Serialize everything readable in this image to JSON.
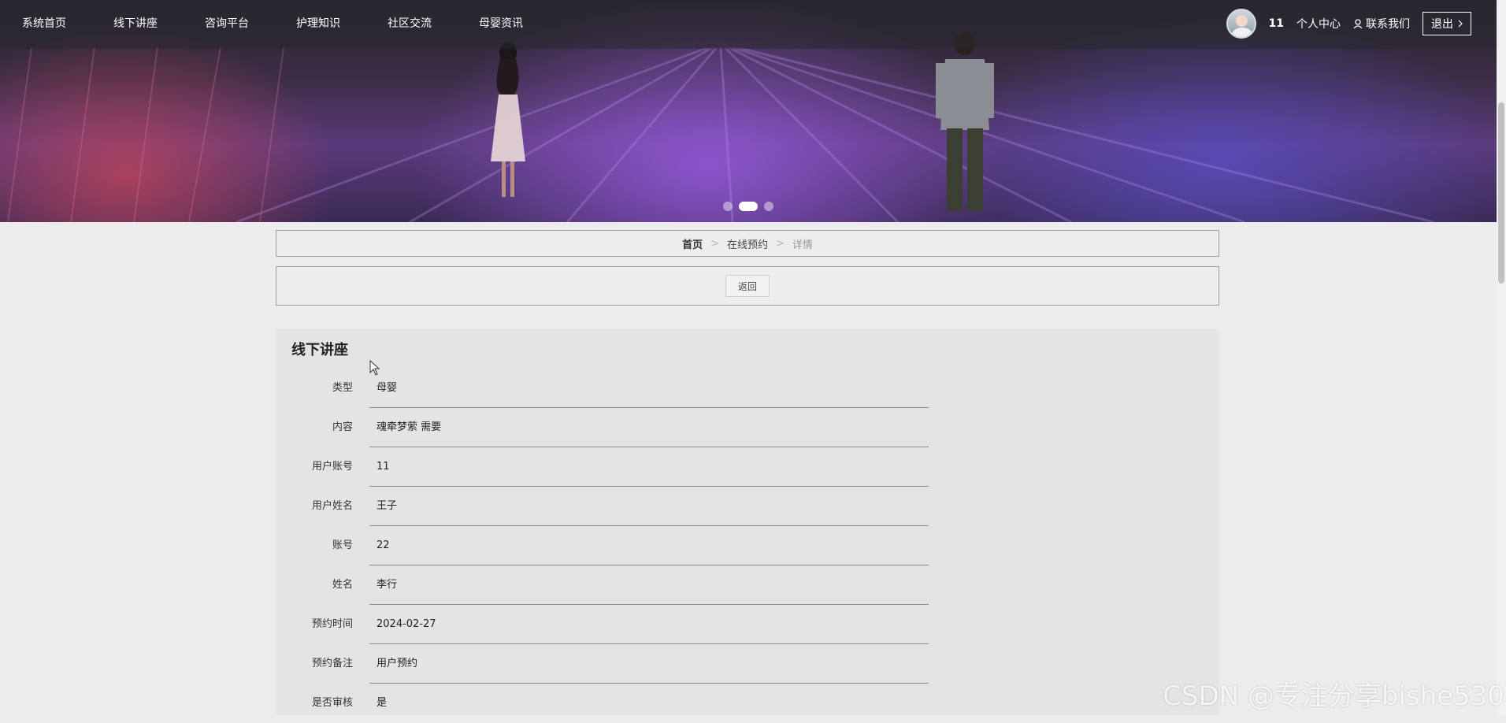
{
  "nav": {
    "items": [
      {
        "label": "系统首页"
      },
      {
        "label": "线下讲座"
      },
      {
        "label": "咨询平台"
      },
      {
        "label": "护理知识"
      },
      {
        "label": "社区交流"
      },
      {
        "label": "母婴资讯"
      }
    ]
  },
  "user": {
    "count": "11",
    "personal_center": "个人中心",
    "contact": "联系我们",
    "logout": "退出"
  },
  "banner": {
    "slides_total": 3,
    "active_slide": 2
  },
  "breadcrumb": {
    "home": "首页",
    "section": "在线预约",
    "current": "详情",
    "separator": ">"
  },
  "actions": {
    "back": "返回"
  },
  "detail": {
    "title": "线下讲座",
    "fields": [
      {
        "label": "类型",
        "value": "母婴"
      },
      {
        "label": "内容",
        "value": "魂牵梦萦 需要"
      },
      {
        "label": "用户账号",
        "value": "11"
      },
      {
        "label": "用户姓名",
        "value": "王子"
      },
      {
        "label": "账号",
        "value": "22"
      },
      {
        "label": "姓名",
        "value": "李行"
      },
      {
        "label": "预约时间",
        "value": "2024-02-27"
      },
      {
        "label": "预约备注",
        "value": "用户预约"
      },
      {
        "label": "是否审核",
        "value": "是"
      }
    ]
  },
  "watermark": "CSDN @专注分享bishe530"
}
